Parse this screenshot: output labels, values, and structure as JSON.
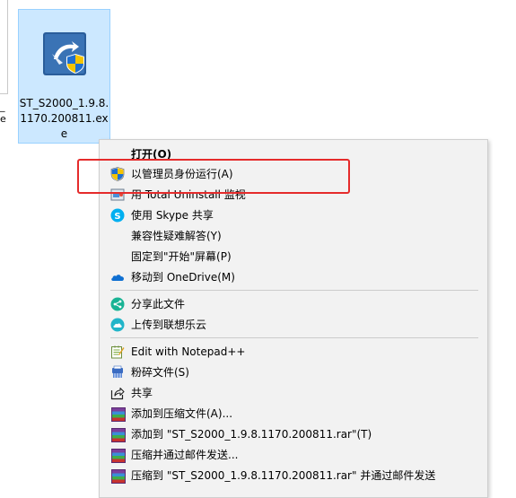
{
  "desktop": {
    "prev_file_labels": [
      "_",
      "e"
    ],
    "selected_file": {
      "name_lines": [
        "ST_S2000_1.9.8.",
        "1170.200811.ex",
        "e"
      ]
    }
  },
  "context_menu": {
    "items": [
      {
        "label": "打开(O)",
        "icon": "none",
        "bold": true
      },
      {
        "label": "以管理员身份运行(A)",
        "icon": "uac-shield-icon"
      },
      {
        "label": "用 Total Uninstall 监视",
        "icon": "total-uninstall-icon"
      },
      {
        "label": "使用 Skype 共享",
        "icon": "skype-icon"
      },
      {
        "label": "兼容性疑难解答(Y)",
        "icon": "none"
      },
      {
        "label": "固定到\"开始\"屏幕(P)",
        "icon": "none"
      },
      {
        "label": "移动到 OneDrive(M)",
        "icon": "onedrive-icon"
      },
      {
        "label": "分享此文件",
        "icon": "share-circle-icon"
      },
      {
        "label": "上传到联想乐云",
        "icon": "lenovo-cloud-icon"
      },
      {
        "label": "Edit with Notepad++",
        "icon": "notepad-plus-plus-icon"
      },
      {
        "label": "粉碎文件(S)",
        "icon": "shred-icon"
      },
      {
        "label": "共享",
        "icon": "share-arrow-icon"
      },
      {
        "label": "添加到压缩文件(A)...",
        "icon": "winrar-icon"
      },
      {
        "label": "添加到 \"ST_S2000_1.9.8.1170.200811.rar\"(T)",
        "icon": "winrar-icon"
      },
      {
        "label": "压缩并通过邮件发送...",
        "icon": "winrar-icon"
      },
      {
        "label": "压缩到 \"ST_S2000_1.9.8.1170.200811.rar\" 并通过邮件发送",
        "icon": "winrar-icon"
      }
    ]
  },
  "colors": {
    "selection_bg": "#cce8ff",
    "selection_border": "#99d1ff",
    "menu_bg": "#f2f2f2",
    "highlight_border": "#e52b2b"
  }
}
